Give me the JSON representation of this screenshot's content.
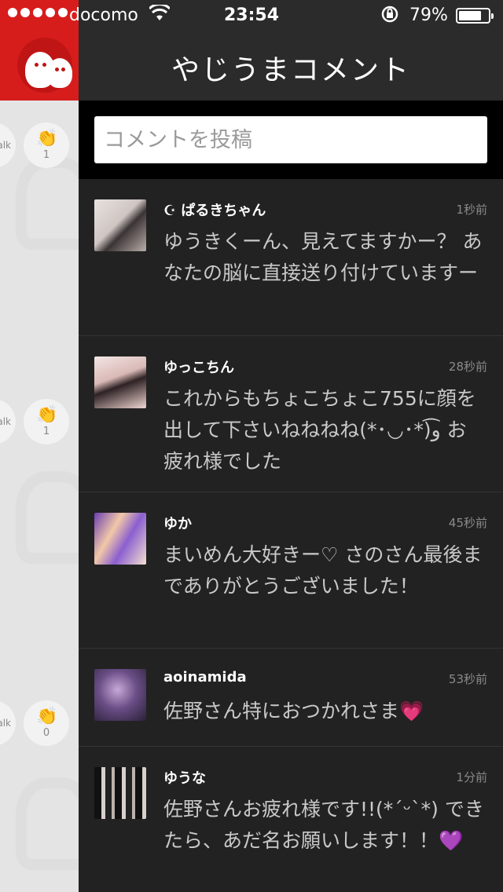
{
  "status_bar": {
    "carrier": "docomo",
    "time": "23:54",
    "battery": "79%",
    "battery_level": 0.79
  },
  "header": {
    "title": "やじうまコメント"
  },
  "composer": {
    "placeholder": "コメントを投稿"
  },
  "side_strip": {
    "talk_label": "alk",
    "rows": [
      {
        "count": "1"
      },
      {
        "count": "1"
      },
      {
        "count": "0"
      }
    ]
  },
  "comments": [
    {
      "name": "☪ ぱるきちゃん",
      "time": "1秒前",
      "text": "ゆうきくーん、見えてますかー？ あなたの脳に直接送り付けていますー"
    },
    {
      "name": "ゆっこちん",
      "time": "28秒前",
      "text": "これからもちょこちょこ755に顔を出して下さいねねねね(*･◡･*)ﻭ͡ お疲れ様でした"
    },
    {
      "name": "ゆか",
      "time": "45秒前",
      "text": "まいめん大好きー♡ さのさん最後までありがとうございました！"
    },
    {
      "name": "aoinamida",
      "time": "53秒前",
      "text": "佐野さん特におつかれさま💗"
    },
    {
      "name": "ゆうな",
      "time": "1分前",
      "text": "佐野さんお疲れ様です!!(*´ᵕ`*) できたら、あだ名お願いします！！💜"
    }
  ],
  "colors": {
    "brand_red": "#d71c1c",
    "background": "#222222",
    "header": "#2b2b2b"
  }
}
